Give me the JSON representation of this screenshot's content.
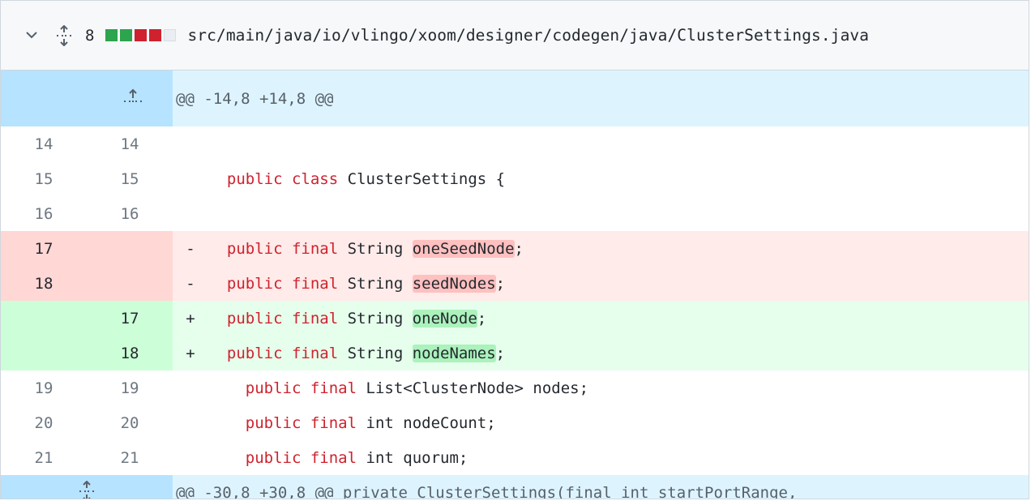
{
  "file_header": {
    "changes": "8",
    "diffstat": [
      "added",
      "added",
      "deleted",
      "deleted",
      "neutral"
    ],
    "path": "src/main/java/io/vlingo/xoom/designer/codegen/java/ClusterSettings.java"
  },
  "hunks": [
    {
      "header": "@@ -14,8 +14,8 @@"
    },
    {
      "header": "@@ -30,8 +30,8 @@ private ClusterSettings(final int startPortRange,"
    }
  ],
  "lines": [
    {
      "old": "14",
      "new": "14",
      "marker": "",
      "indent": "",
      "kw": "",
      "rest": "",
      "hl": "",
      "tail": ""
    },
    {
      "old": "15",
      "new": "15",
      "marker": "",
      "indent": "  ",
      "kw": "public class",
      "rest": " ClusterSettings {",
      "hl": "",
      "tail": ""
    },
    {
      "old": "16",
      "new": "16",
      "marker": "",
      "indent": "",
      "kw": "",
      "rest": "",
      "hl": "",
      "tail": ""
    },
    {
      "old": "17",
      "new": "",
      "marker": "-",
      "indent": "  ",
      "kw": "public final",
      "rest": " String ",
      "hl": "oneSeedNode",
      "tail": ";"
    },
    {
      "old": "18",
      "new": "",
      "marker": "-",
      "indent": "  ",
      "kw": "public final",
      "rest": " String ",
      "hl": "seedNodes",
      "tail": ";"
    },
    {
      "old": "",
      "new": "17",
      "marker": "+",
      "indent": "  ",
      "kw": "public final",
      "rest": " String ",
      "hl": "oneNode",
      "tail": ";"
    },
    {
      "old": "",
      "new": "18",
      "marker": "+",
      "indent": "  ",
      "kw": "public final",
      "rest": " String ",
      "hl": "nodeNames",
      "tail": ";"
    },
    {
      "old": "19",
      "new": "19",
      "marker": "",
      "indent": "    ",
      "kw": "public final",
      "rest": " List<ClusterNode> nodes;",
      "hl": "",
      "tail": ""
    },
    {
      "old": "20",
      "new": "20",
      "marker": "",
      "indent": "    ",
      "kw": "public final",
      "rest": " int nodeCount;",
      "hl": "",
      "tail": ""
    },
    {
      "old": "21",
      "new": "21",
      "marker": "",
      "indent": "    ",
      "kw": "public final",
      "rest": " int quorum;",
      "hl": "",
      "tail": ""
    }
  ],
  "colors": {
    "keyword": "#cf222e",
    "added_bg": "#e6ffec",
    "deleted_bg": "#ffebe9",
    "hunk_bg": "#ddf4ff"
  },
  "icons": {
    "collapse": "chevron-down-icon",
    "expand_all": "unfold-icon",
    "expand_up": "fold-up-icon",
    "expand_both": "unfold-icon"
  }
}
